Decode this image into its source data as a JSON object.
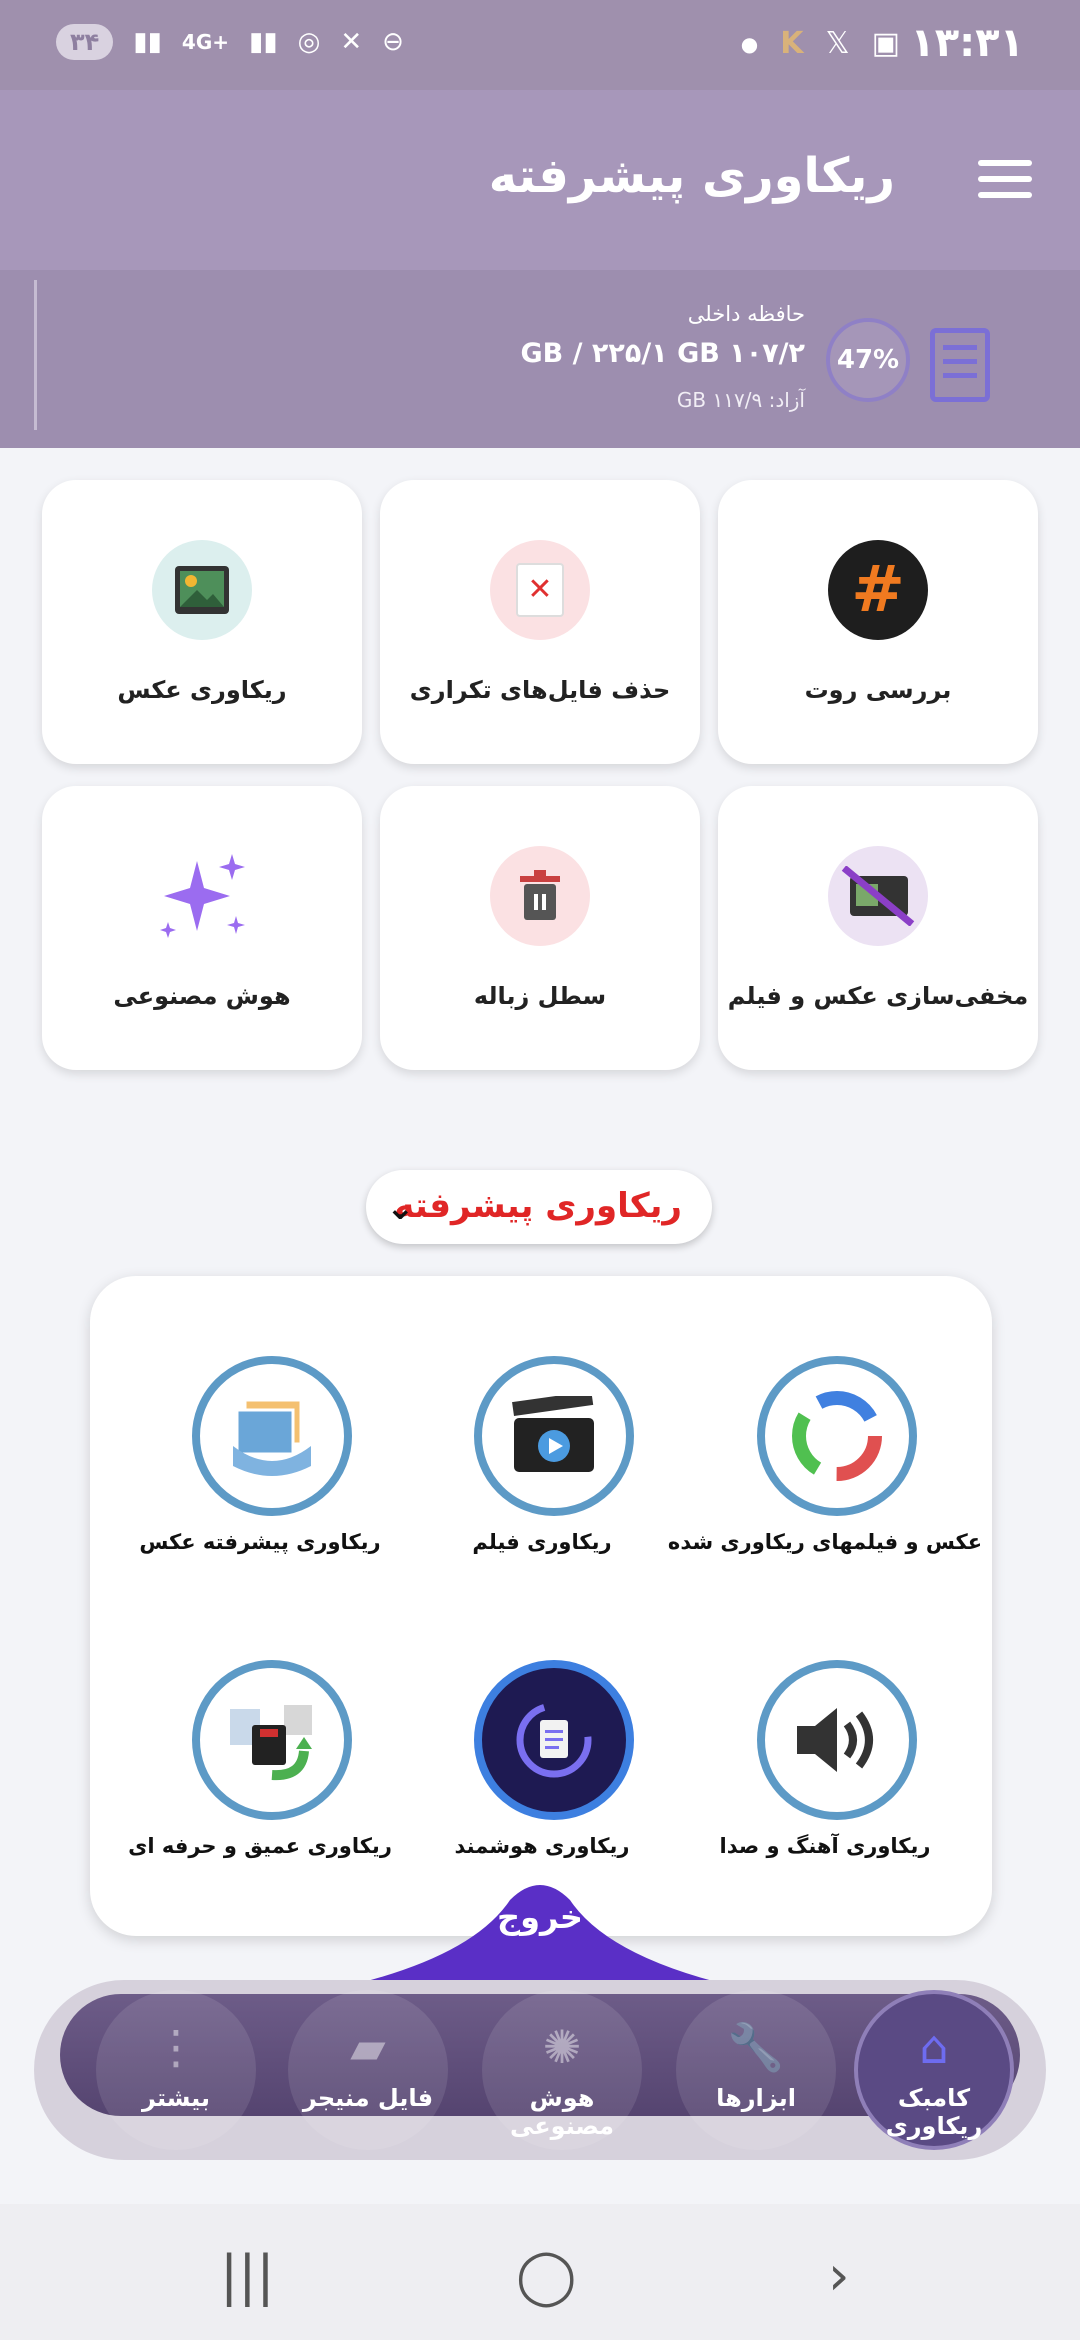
{
  "status_bar": {
    "time": "۱۳:۳۱",
    "battery": "۳۴",
    "network": "4G+"
  },
  "app_bar": {
    "title": "ریکاوری پیشرفته"
  },
  "storage": {
    "label": "حافظه داخلی",
    "size": "۱۰۷/۲ GB / ۲۲۵/۱ GB",
    "free": "آزاد: ۱۱۷/۹ GB",
    "percent": "47%"
  },
  "tools": [
    {
      "label": "بررسی روت",
      "icon": "root-hash-icon"
    },
    {
      "label": "حذف فایل‌های تکراری",
      "icon": "duplicate-delete-icon"
    },
    {
      "label": "ریکاوری عکس",
      "icon": "photo-icon"
    },
    {
      "label": "مخفی‌سازی عکس و فیلم",
      "icon": "hide-media-icon"
    },
    {
      "label": "سطل زباله",
      "icon": "trash-icon"
    },
    {
      "label": "هوش مصنوعی",
      "icon": "sparkle-icon"
    }
  ],
  "advanced": {
    "toggle_label": "ریکاوری پیشرفته",
    "items": [
      {
        "label": "عکس و فیلمهای ریکاوری شده",
        "icon": "recycle-arrows-icon"
      },
      {
        "label": "ریکاوری فیلم",
        "icon": "clapperboard-icon"
      },
      {
        "label": "ریکاوری پیشرفته عکس",
        "icon": "photo-stack-icon"
      },
      {
        "label": "ریکاوری آهنگ و صدا",
        "icon": "speaker-icon"
      },
      {
        "label": "ریکاوری هوشمند",
        "icon": "smart-recovery-icon"
      },
      {
        "label": "ریکاوری عمیق و حرفه ای",
        "icon": "deep-recovery-icon"
      }
    ]
  },
  "exit_label": "خروج",
  "bottom_nav": [
    {
      "label": "کامبک ریکاوری",
      "icon": "home-icon",
      "active": true
    },
    {
      "label": "ابزارها",
      "icon": "wrench-icon"
    },
    {
      "label": "هوش مصنوعی",
      "icon": "ai-icon"
    },
    {
      "label": "فایل منیجر",
      "icon": "folder-icon"
    },
    {
      "label": "بیشتر",
      "icon": "more-dots-icon"
    }
  ]
}
